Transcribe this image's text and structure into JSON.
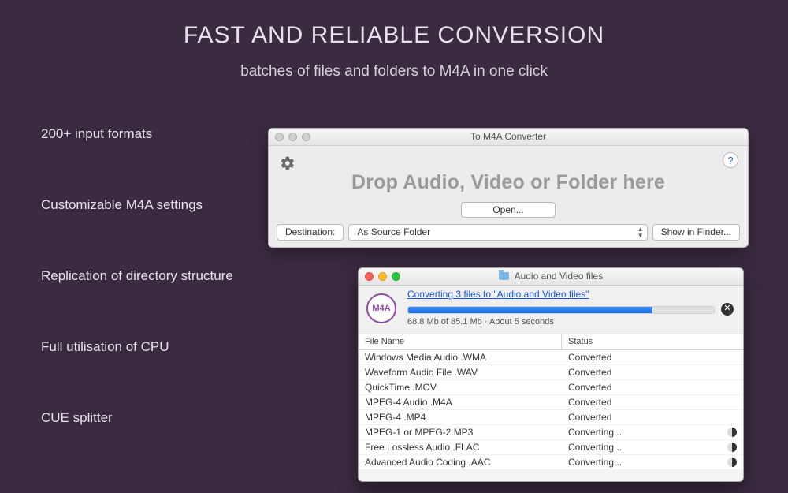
{
  "hero": {
    "title": "FAST AND RELIABLE CONVERSION",
    "subtitle": "batches of files and folders to M4A in one click"
  },
  "features": [
    "200+ input formats",
    "Customizable M4A settings",
    "Replication of directory structure",
    "Full utilisation of CPU",
    "CUE splitter"
  ],
  "converter_window": {
    "title": "To M4A Converter",
    "drop_label": "Drop Audio, Video or Folder here",
    "open_label": "Open...",
    "destination_label": "Destination:",
    "destination_value": "As Source Folder",
    "show_in_finder_label": "Show in Finder...",
    "help_tooltip": "?"
  },
  "progress_window": {
    "title": "Audio and Video files",
    "badge_text": "M4A",
    "link_text": "Converting 3 files to \"Audio and Video files\"",
    "progress_percent": 80,
    "progress_text": "68.8 Mb of 85.1 Mb · About 5 seconds",
    "columns": {
      "file": "File Name",
      "status": "Status"
    },
    "rows": [
      {
        "name": "Windows Media Audio .WMA",
        "status": "Converted",
        "busy": false
      },
      {
        "name": "Waveform Audio File .WAV",
        "status": "Converted",
        "busy": false
      },
      {
        "name": "QuickTime .MOV",
        "status": "Converted",
        "busy": false
      },
      {
        "name": "MPEG-4 Audio .M4A",
        "status": "Converted",
        "busy": false
      },
      {
        "name": "MPEG-4 .MP4",
        "status": "Converted",
        "busy": false
      },
      {
        "name": "MPEG-1 or MPEG-2.MP3",
        "status": "Converting...",
        "busy": true
      },
      {
        "name": "Free Lossless Audio .FLAC",
        "status": "Converting...",
        "busy": true
      },
      {
        "name": "Advanced Audio Coding .AAC",
        "status": "Converting...",
        "busy": true
      }
    ]
  }
}
